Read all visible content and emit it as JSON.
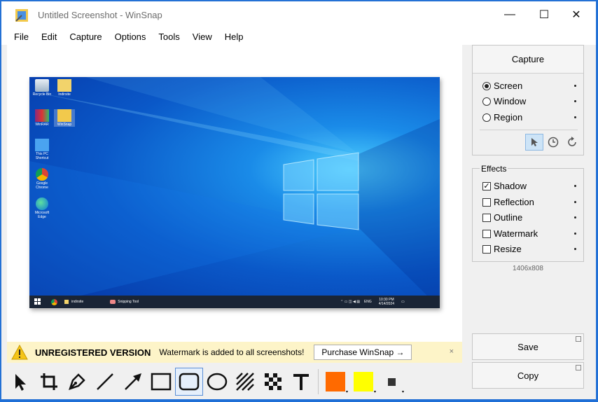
{
  "window": {
    "title": "Untitled Screenshot - WinSnap",
    "minimize": "—",
    "maximize": "☐",
    "close": "✕"
  },
  "menu": [
    "File",
    "Edit",
    "Capture",
    "Options",
    "Tools",
    "View",
    "Help"
  ],
  "desktop": {
    "icons": [
      "Recycle Bin",
      "Indirsite",
      "WinRAR",
      "WinSnap",
      "This PC Shortcut",
      "Google Chrome",
      "Microsoft Edge"
    ],
    "taskbar": {
      "item1": "indirsite",
      "item2": "Snipping Tool",
      "lang": "ENG",
      "time": "10:30 PM",
      "date": "4/14/2024"
    }
  },
  "notice": {
    "title": "UNREGISTERED VERSION",
    "text": "Watermark is added to all screenshots!",
    "button": "Purchase WinSnap →",
    "close": "×"
  },
  "panel": {
    "capture_label": "Capture",
    "modes": [
      {
        "label": "Screen",
        "selected": true
      },
      {
        "label": "Window",
        "selected": false
      },
      {
        "label": "Region",
        "selected": false
      }
    ],
    "effects_label": "Effects",
    "effects": [
      {
        "label": "Shadow",
        "checked": true
      },
      {
        "label": "Reflection",
        "checked": false
      },
      {
        "label": "Outline",
        "checked": false
      },
      {
        "label": "Watermark",
        "checked": false
      },
      {
        "label": "Resize",
        "checked": false
      }
    ],
    "dimensions": "1406x808",
    "save_label": "Save",
    "copy_label": "Copy"
  },
  "colors": {
    "primary": "#ff6a00",
    "secondary": "#ffff00",
    "accent": "#1f6fd6"
  },
  "tools": [
    "select-arrow",
    "crop",
    "pen",
    "line",
    "arrow",
    "rectangle",
    "rounded-rectangle",
    "ellipse",
    "hatch",
    "pixelate",
    "text",
    "primary-color",
    "secondary-color",
    "line-width"
  ]
}
